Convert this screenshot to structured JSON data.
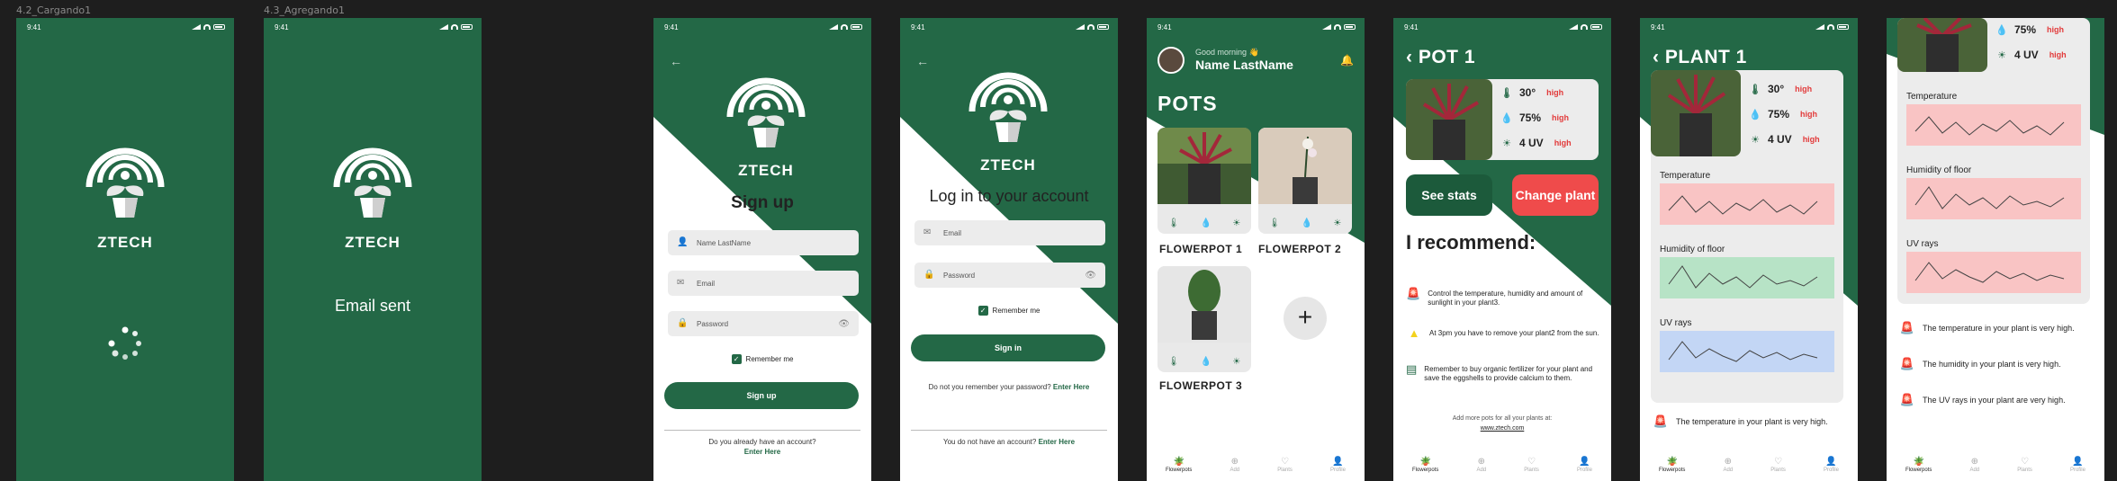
{
  "frames": {
    "loading_label": "4.2_Cargando1",
    "added_label": "4.3_Agregando1"
  },
  "status": {
    "time": "9:41"
  },
  "brand": {
    "name": "ZTECH",
    "accent": "#236846",
    "alert": "#e23b3b",
    "chart_red": "#f9c4c4",
    "chart_green": "#b7e3c6",
    "chart_blue": "#c3d6f5"
  },
  "email_screen": {
    "message": "Email sent"
  },
  "signup": {
    "title": "Sign up",
    "name_placeholder": "Name LastName",
    "email_placeholder": "Email",
    "password_placeholder": "Password",
    "remember": "Remember me",
    "button": "Sign up",
    "footer": "Do you already have an account?",
    "footer_link": "Enter Here"
  },
  "login": {
    "title": "Log in to your account",
    "email_placeholder": "Email",
    "password_placeholder": "Password",
    "remember": "Remember me",
    "button": "Sign in",
    "forgot": "Do not you remember your password?",
    "forgot_link": "Enter Here",
    "footer": "You do not have an account?",
    "footer_link": "Enter Here"
  },
  "home": {
    "greeting": "Good morning 👋",
    "user": "Name LastName",
    "title": "POTS",
    "pots": [
      "FLOWERPOT 1",
      "FLOWERPOT 2",
      "FLOWERPOT 3"
    ],
    "add_symbol": "+"
  },
  "nav": {
    "flowerpots": "Flowerpots",
    "add": "Add",
    "plants": "Plants",
    "profile": "Profile"
  },
  "pot1": {
    "title": "POT 1",
    "temp": "30°",
    "humidity": "75%",
    "uv": "4 UV",
    "level": "high",
    "see_stats": "See stats",
    "change_plant": "Change plant",
    "recommend_title": "I recommend:",
    "recs": [
      "Control the temperature, humidity and amount of sunlight in your plant3.",
      "At 3pm you have to remove your plant2 from the sun.",
      "Remember to buy organic fertilizer for your plant and save the eggshells to provide calcium to them."
    ],
    "more_text": "Add more pots for all your plants at:",
    "more_link": "www.ztech.com"
  },
  "plant1": {
    "title": "PLANT 1",
    "temp": "30°",
    "humidity": "75%",
    "uv": "4 UV",
    "level": "high",
    "charts": [
      "Temperature",
      "Humidity of floor",
      "UV rays"
    ],
    "alert": "The temperature in your plant is very high."
  },
  "plant_scroll": {
    "humidity": "75%",
    "uv": "4 UV",
    "level": "high",
    "charts": [
      "Temperature",
      "Humidity of floor",
      "UV rays"
    ],
    "alerts": [
      "The temperature in your plant is very high.",
      "The humidity in your plant is very high.",
      "The UV rays in your plant are very high."
    ]
  }
}
